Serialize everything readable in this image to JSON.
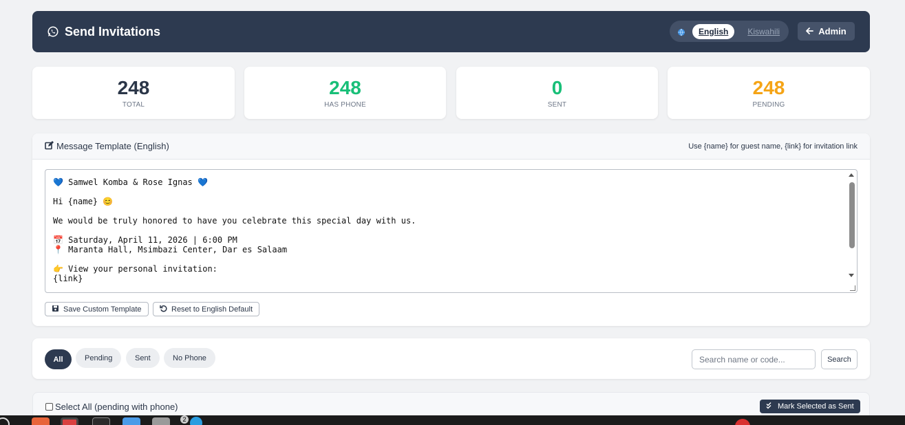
{
  "header": {
    "title": "Send Invitations",
    "languages": [
      "English",
      "Kiswahili"
    ],
    "active_language": "English",
    "admin_label": "Admin"
  },
  "stats": [
    {
      "value": "248",
      "label": "TOTAL",
      "color": "#2b3648"
    },
    {
      "value": "248",
      "label": "HAS PHONE",
      "color": "#18bf78"
    },
    {
      "value": "0",
      "label": "SENT",
      "color": "#18bf78"
    },
    {
      "value": "248",
      "label": "PENDING",
      "color": "#f5a416"
    }
  ],
  "template": {
    "title": "Message Template (English)",
    "hint": "Use {name} for guest name, {link} for invitation link",
    "text": "💙 Samwel Komba & Rose Ignas 💙\n\nHi {name} 😊\n\nWe would be truly honored to have you celebrate this special day with us.\n\n📅 Saturday, April 11, 2026 | 6:00 PM\n📍 Maranta Hall, Msimbazi Center, Dar es Salaam\n\n👉 View your personal invitation:\n{link}",
    "save_label": "Save Custom Template",
    "reset_label": "Reset to English Default"
  },
  "filters": {
    "tabs": [
      "All",
      "Pending",
      "Sent",
      "No Phone"
    ],
    "active_tab": "All",
    "search_placeholder": "Search name or code...",
    "search_label": "Search"
  },
  "selection": {
    "select_all_label": "Select All (pending with phone)",
    "mark_sent_label": "Mark Selected as Sent"
  },
  "taskbar": {
    "badge": "2"
  }
}
